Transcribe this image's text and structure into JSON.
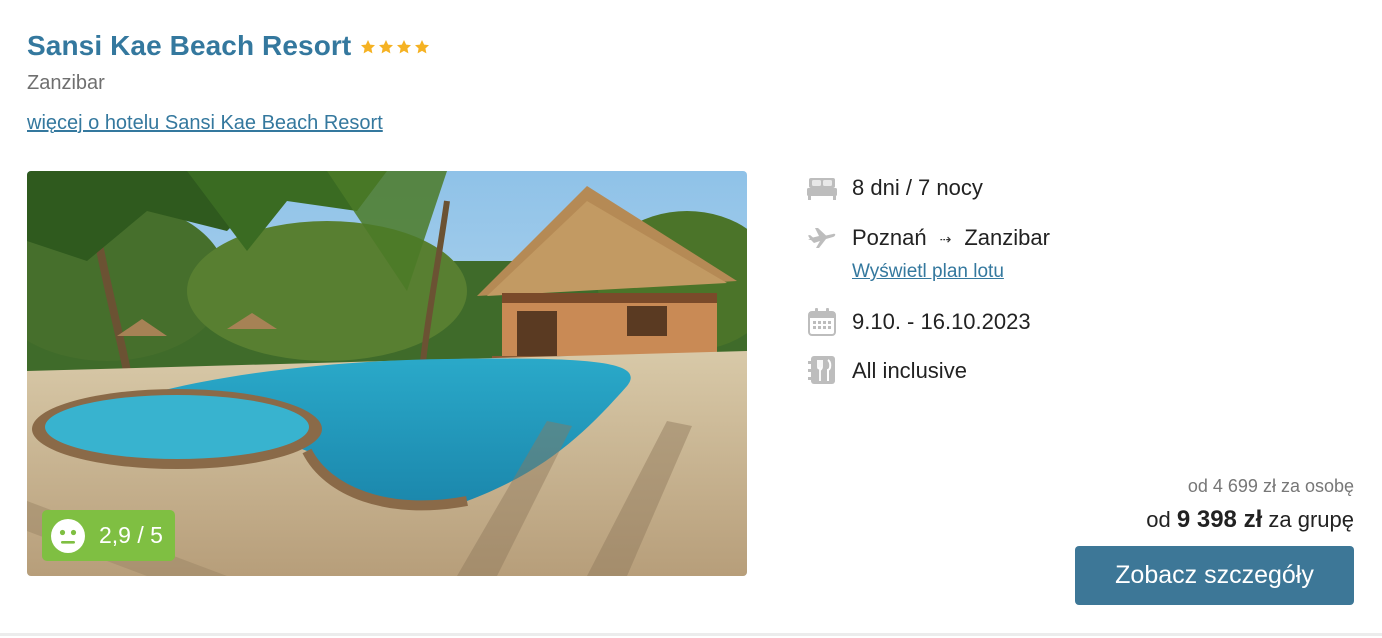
{
  "hotel": {
    "name": "Sansi Kae Beach Resort",
    "stars": 4,
    "star_color": "#f5b223",
    "location": "Zanzibar",
    "more_link": "więcej o hotelu Sansi Kae Beach Resort"
  },
  "rating": {
    "value": "2,9 / 5",
    "face_icon": "neutral-face-icon",
    "badge_color": "#7fbf42"
  },
  "details": {
    "duration": "8 dni / 7 nocy",
    "flight_from": "Poznań",
    "flight_arrow": "⇢",
    "flight_to": "Zanzibar",
    "flight_plan_link": "Wyświetl plan lotu",
    "dates": "9.10. - 16.10.2023",
    "board": "All inclusive",
    "icons": [
      "bed-icon",
      "plane-icon",
      "calendar-icon",
      "cutlery-icon"
    ]
  },
  "price": {
    "per_person": "od 4 699 zł za osobę",
    "group_prefix": "od",
    "group_amount": "9 398 zł",
    "group_suffix": "za grupę"
  },
  "cta": {
    "label": "Zobacz szczegóły",
    "color": "#3d7797"
  },
  "colors": {
    "link": "#34789e"
  }
}
